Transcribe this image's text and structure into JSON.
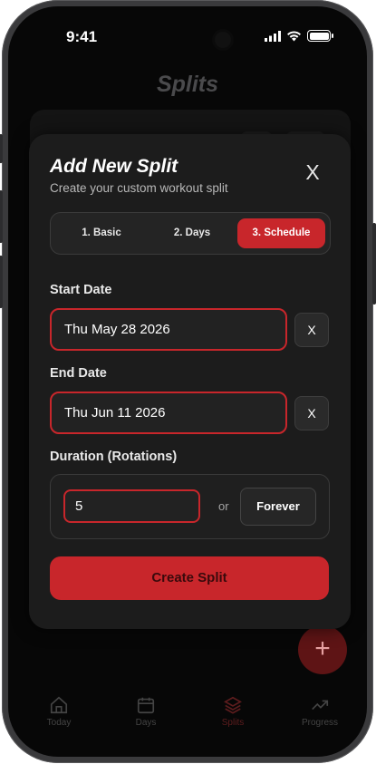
{
  "status_bar": {
    "time": "9:41"
  },
  "page_title": "Splits",
  "modal": {
    "title": "Add New Split",
    "subtitle": "Create your custom workout split",
    "close_label": "X",
    "steps": [
      {
        "label": "1. Basic",
        "active": false
      },
      {
        "label": "2. Days",
        "active": false
      },
      {
        "label": "3. Schedule",
        "active": true
      }
    ],
    "start_date": {
      "label": "Start Date",
      "value": "Thu May 28 2026",
      "clear_label": "X"
    },
    "end_date": {
      "label": "End Date",
      "value": "Thu Jun 11 2026",
      "clear_label": "X"
    },
    "duration": {
      "label": "Duration (Rotations)",
      "value": "5",
      "or_text": "or",
      "forever_label": "Forever"
    },
    "create_label": "Create Split"
  },
  "fab_label": "+",
  "tabbar": [
    {
      "label": "Today",
      "icon": "home-icon"
    },
    {
      "label": "Days",
      "icon": "calendar-icon"
    },
    {
      "label": "Splits",
      "icon": "layers-icon",
      "active": true
    },
    {
      "label": "Progress",
      "icon": "trending-up-icon"
    }
  ],
  "colors": {
    "accent": "#c8262b",
    "background": "#070707",
    "modal": "#1c1c1c"
  }
}
